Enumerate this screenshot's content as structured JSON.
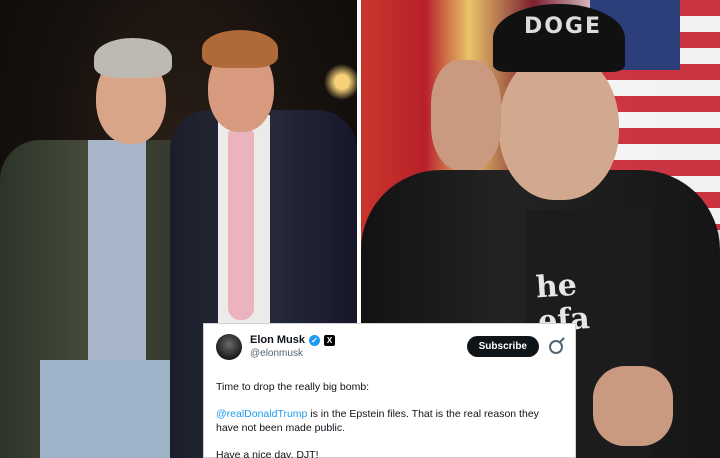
{
  "cap": {
    "text": "DOGE"
  },
  "shirt_print": {
    "line1": "he",
    "line2": "efa"
  },
  "tweet": {
    "name": "Elon Musk",
    "verified_glyph": "✓",
    "x_glyph": "X",
    "handle": "@elonmusk",
    "subscribe_label": "Subscribe",
    "line1": "Time to drop the really big bomb:",
    "mention": "@realDonaldTrump",
    "line2_rest": " is in the Epstein files. That is the real reason they have not been made public.",
    "line3": "Have a nice day, DJT!"
  },
  "colors": {
    "mention": "#1d9bf0",
    "verified": "#1d9bf0",
    "subscribe_bg": "#0f1419"
  }
}
